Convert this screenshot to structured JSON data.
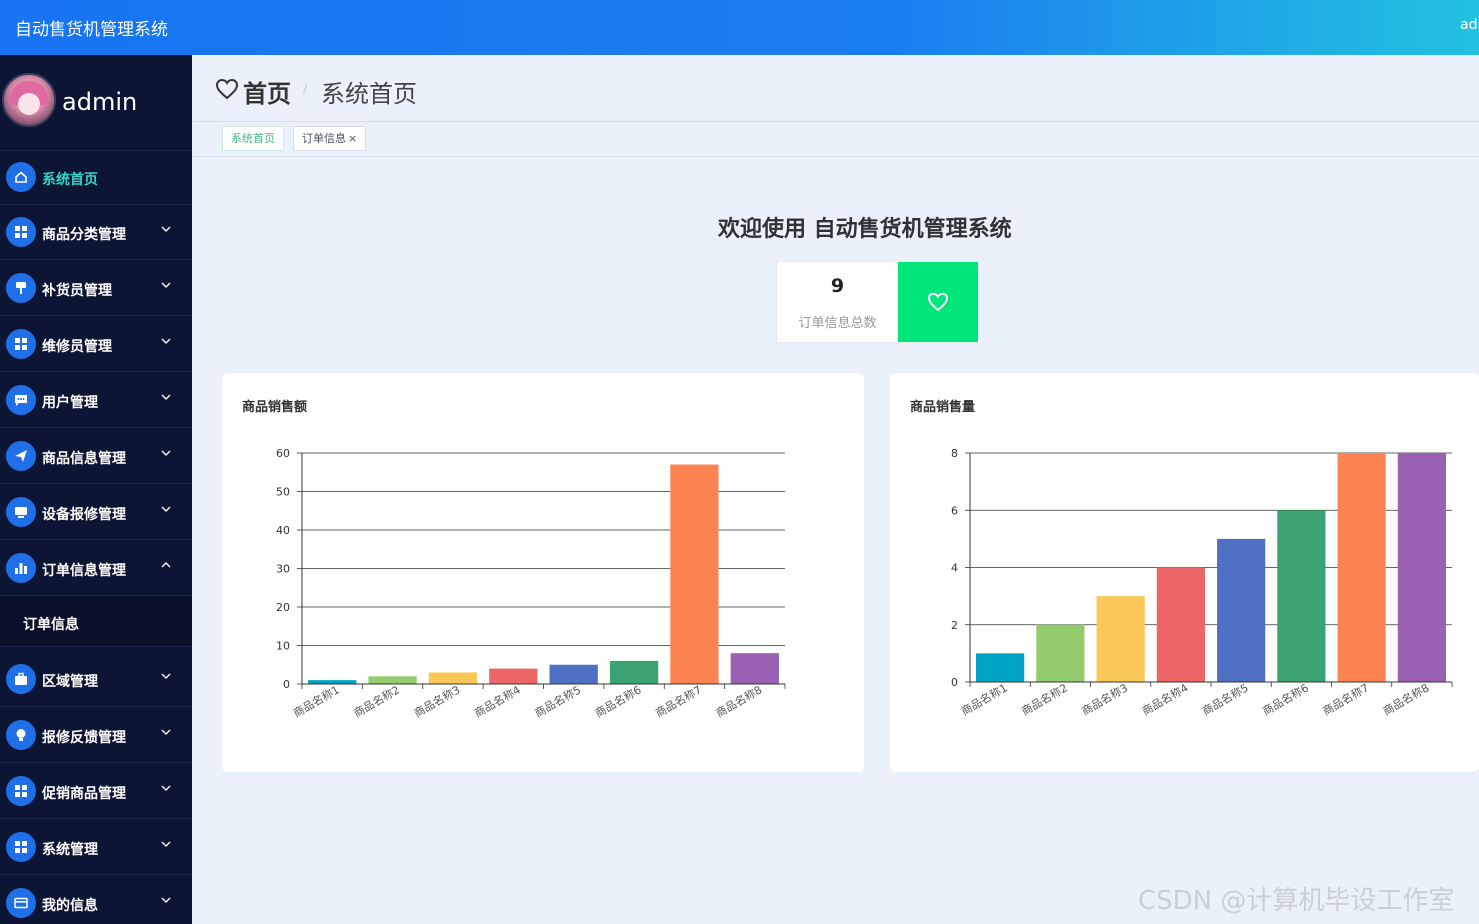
{
  "app": {
    "title": "自动售货机管理系统",
    "top_user": "admin"
  },
  "sidebar": {
    "username": "admin",
    "items": [
      {
        "label": "系统首页",
        "icon": "home-icon",
        "active": true,
        "expand": "none"
      },
      {
        "label": "商品分类管理",
        "icon": "grid-icon",
        "expand": "down"
      },
      {
        "label": "补货员管理",
        "icon": "brush-icon",
        "expand": "down"
      },
      {
        "label": "维修员管理",
        "icon": "grid-icon",
        "expand": "down"
      },
      {
        "label": "用户管理",
        "icon": "chat-icon",
        "expand": "down"
      },
      {
        "label": "商品信息管理",
        "icon": "send-icon",
        "expand": "down"
      },
      {
        "label": "设备报修管理",
        "icon": "monitor-icon",
        "expand": "down"
      },
      {
        "label": "订单信息管理",
        "icon": "bar-chart-icon",
        "expand": "up"
      },
      {
        "label": "区域管理",
        "icon": "briefcase-icon",
        "expand": "down"
      },
      {
        "label": "报修反馈管理",
        "icon": "bulb-icon",
        "expand": "down"
      },
      {
        "label": "促销商品管理",
        "icon": "grid-icon",
        "expand": "down"
      },
      {
        "label": "系统管理",
        "icon": "grid-icon",
        "expand": "down"
      },
      {
        "label": "我的信息",
        "icon": "card-icon",
        "expand": "down"
      }
    ],
    "submenu": {
      "label": "订单信息"
    }
  },
  "header": {
    "title": "首页",
    "separator": "/",
    "subtitle": "系统首页"
  },
  "tabs": [
    {
      "label": "系统首页",
      "active": true
    },
    {
      "label": "订单信息",
      "active": false,
      "close": "×"
    }
  ],
  "main": {
    "welcome": "欢迎使用 自动售货机管理系统",
    "stat": {
      "value": "9",
      "label": "订单信息总数",
      "icon": "heart-icon",
      "color": "#00e67a"
    }
  },
  "chart_data": [
    {
      "type": "bar",
      "title": "商品销售额",
      "categories": [
        "商品名称1",
        "商品名称2",
        "商品名称3",
        "商品名称4",
        "商品名称5",
        "商品名称6",
        "商品名称7",
        "商品名称8"
      ],
      "values": [
        1,
        2,
        3,
        4,
        5,
        6,
        57,
        8
      ],
      "ylim": [
        0,
        60
      ],
      "yticks": [
        0,
        10,
        20,
        30,
        40,
        50,
        60
      ],
      "grid": true,
      "colors": [
        "#00a3c4",
        "#93cc6c",
        "#f9c858",
        "#ec6666",
        "#4f6fc3",
        "#3ba272",
        "#fc8452",
        "#9a60b4"
      ]
    },
    {
      "type": "bar",
      "title": "商品销售量",
      "categories": [
        "商品名称1",
        "商品名称2",
        "商品名称3",
        "商品名称4",
        "商品名称5",
        "商品名称6",
        "商品名称7",
        "商品名称8"
      ],
      "values": [
        1,
        2,
        3,
        4,
        5,
        6,
        8,
        8
      ],
      "ylim": [
        0,
        8
      ],
      "yticks": [
        0,
        2,
        4,
        6,
        8
      ],
      "grid": true,
      "colors": [
        "#00a3c4",
        "#93cc6c",
        "#f9c858",
        "#ec6666",
        "#4f6fc3",
        "#3ba272",
        "#fc8452",
        "#9a60b4"
      ]
    }
  ],
  "colors": {
    "topbar": "#1874f2",
    "sidebar": "#0d1535",
    "accent": "#33d4c4",
    "icon_bg": "#1f6fe8"
  },
  "watermark": "CSDN @计算机毕设工作室"
}
